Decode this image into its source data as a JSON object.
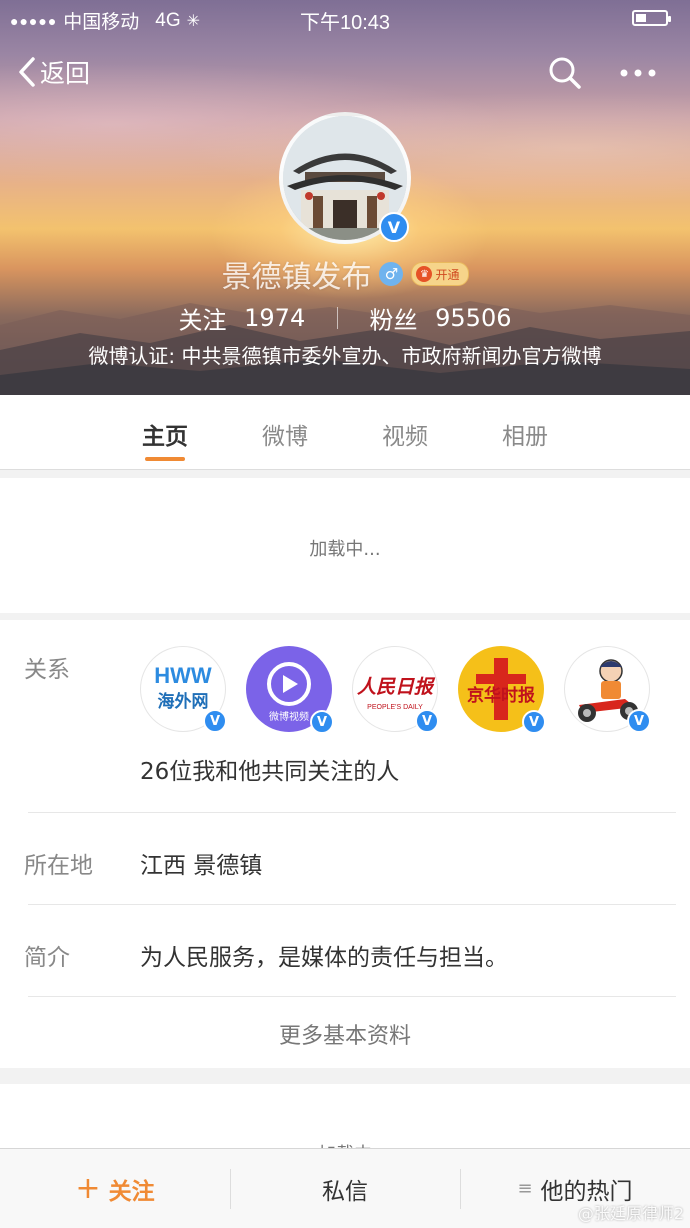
{
  "status_bar": {
    "carrier": "中国移动",
    "network": "4G",
    "time": "下午10:43"
  },
  "nav": {
    "back_label": "返回"
  },
  "profile": {
    "name": "景德镇发布",
    "vip_label": "开通",
    "following_label": "关注",
    "following_count": "1974",
    "followers_label": "粉丝",
    "followers_count": "95506",
    "verification": "微博认证: 中共景德镇市委外宣办、市政府新闻办官方微博"
  },
  "tabs": [
    {
      "label": "主页",
      "active": true
    },
    {
      "label": "微博",
      "active": false
    },
    {
      "label": "视频",
      "active": false
    },
    {
      "label": "相册",
      "active": false
    }
  ],
  "loading_text": "加载中...",
  "relations": {
    "label": "关系",
    "accounts": [
      {
        "icon": "haiwai-logo",
        "caption": "海外网"
      },
      {
        "icon": "weibo-video-logo",
        "caption": "微博视频"
      },
      {
        "icon": "peoples-daily-logo",
        "caption": "人民日报"
      },
      {
        "icon": "jinghua-times-logo",
        "caption": "京华时报"
      },
      {
        "icon": "cartoon-police-logo",
        "caption": ""
      }
    ],
    "mutual_text": "26位我和他共同关注的人"
  },
  "location": {
    "label": "所在地",
    "value": "江西 景德镇"
  },
  "intro": {
    "label": "简介",
    "value": "为人民服务，是媒体的责任与担当。"
  },
  "more_info_label": "更多基本资料",
  "loading_text_2": "加载中",
  "bottom_bar": {
    "follow_label": "关注",
    "message_label": "私信",
    "hot_label": "他的热门"
  },
  "watermark": "@张廷原律师2",
  "colors": {
    "accent": "#f08a34",
    "verified_blue": "#2f8df0"
  }
}
